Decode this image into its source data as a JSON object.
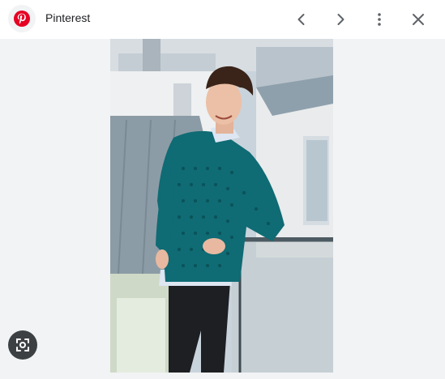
{
  "header": {
    "source_name": "Pinterest",
    "logo_icon": "pinterest-logo",
    "logo_color": "#e60023"
  },
  "toolbar": {
    "prev_icon": "chevron-left-icon",
    "next_icon": "chevron-right-icon",
    "more_icon": "more-vert-icon",
    "close_icon": "close-icon"
  },
  "viewer": {
    "background": "#f1f3f4",
    "lens_icon": "lens-icon"
  }
}
